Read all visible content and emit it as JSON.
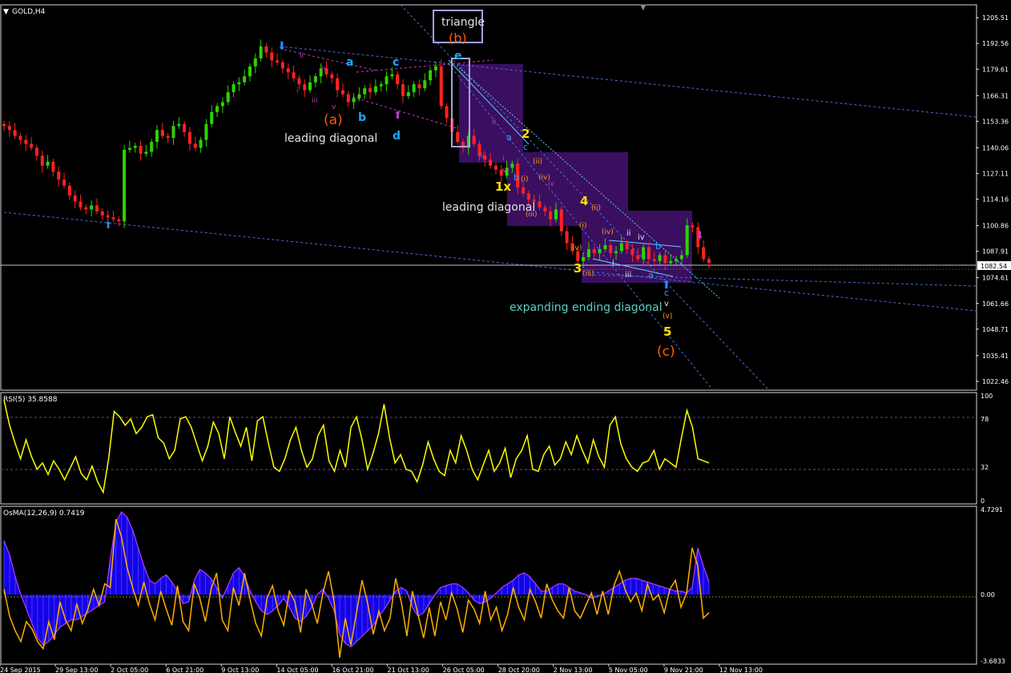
{
  "window": {
    "symbol_title": "GOLD,H4"
  },
  "colors": {
    "background": "#000000",
    "bull_candle": "#2bd400",
    "bear_candle": "#ff2222",
    "rsi_line": "#ffff00",
    "osma_histogram": "#1a00ff",
    "osma_line": "#ffb000",
    "channel_lines": "#4a6fd4",
    "zone_fill": "#3a0f60",
    "last_price_box": "#ffffff"
  },
  "price_panel": {
    "last_price": "1082.54",
    "y_ticks": [
      "1205.51",
      "1192.56",
      "1179.61",
      "1166.31",
      "1153.36",
      "1140.06",
      "1127.11",
      "1114.16",
      "1100.86",
      "1087.91",
      "1074.61",
      "1061.66",
      "1048.71",
      "1035.41",
      "1022.46"
    ]
  },
  "rsi_panel": {
    "label": "RSI(5) 35.8588",
    "y_ticks": [
      "100",
      "78",
      "32",
      "0"
    ]
  },
  "osma_panel": {
    "label": "OsMA(12,26,9) 0.7419",
    "y_ticks": [
      "4.7291",
      "0.00",
      "-3.6833"
    ]
  },
  "x_ticks": [
    "24 Sep 2015",
    "29 Sep 13:00",
    "2 Oct 05:00",
    "6 Oct 21:00",
    "9 Oct 13:00",
    "14 Oct 05:00",
    "16 Oct 21:00",
    "21 Oct 13:00",
    "26 Oct 05:00",
    "28 Oct 20:00",
    "2 Nov 13:00",
    "5 Nov 05:00",
    "9 Nov 21:00",
    "12 Nov 13:00"
  ],
  "annotations": {
    "triangle": "triangle",
    "wave_b_big": "(b)",
    "wave_a_big": "(a)",
    "wave_c_big": "(c)",
    "leading_diagonal_1": "leading diagonal",
    "leading_diagonal_2": "leading diagonal",
    "expanding_ending_diagonal": "expanding ending diagonal",
    "tri_a": "a",
    "tri_b": "b",
    "tri_c": "c",
    "tri_d": "d",
    "tri_e": "e",
    "w_1x": "1x",
    "w_2": "2",
    "w_3": "3",
    "w_4": "4",
    "w_5": "5",
    "ld_ii": "ii",
    "ld_iv": "iv",
    "ld_i": "i",
    "ld_iii": "iii",
    "ld_v": "v",
    "sub_ii_a": "(ii)",
    "sub_i_a": "(i)",
    "sub_iv_a": "(iv)",
    "sub_iii_a": "(iii)",
    "sub_ii_b": "(ii)",
    "sub_i_b": "(i)",
    "sub_iv_b": "(iv)",
    "sub_v_b": "(v)",
    "sub_iii_b": "(iii)",
    "sub_v_c": "(v)",
    "m_ii": "ii",
    "m_iv": "iv",
    "m_i": "i",
    "m_iii": "iii",
    "m_v": "v",
    "e_ii": "ii",
    "e_iv": "iv",
    "e_i": "i",
    "e_iii": "iii",
    "e_v": "v",
    "e_a": "a",
    "e_b": "b",
    "e_c": "c",
    "s_a": "a",
    "s_b": "b",
    "s_c": "c"
  },
  "chart_data": [
    {
      "type": "candlestick",
      "title": "GOLD,H4",
      "ylim": [
        1018,
        1212
      ],
      "last_price": 1082.54,
      "series": [
        {
          "name": "GOLD,H4",
          "close": [
            1151,
            1149,
            1146,
            1144,
            1142,
            1140,
            1136,
            1131,
            1133,
            1128,
            1124,
            1121,
            1116,
            1113,
            1110,
            1109,
            1111,
            1108,
            1106,
            1105,
            1104,
            1103,
            1139,
            1140,
            1141,
            1137,
            1138,
            1143,
            1149,
            1146,
            1145,
            1151,
            1152,
            1148,
            1142,
            1140,
            1144,
            1152,
            1158,
            1161,
            1163,
            1168,
            1172,
            1173,
            1176,
            1181,
            1185,
            1191,
            1188,
            1184,
            1183,
            1180,
            1178,
            1175,
            1172,
            1169,
            1173,
            1176,
            1180,
            1177,
            1175,
            1169,
            1167,
            1163,
            1165,
            1167,
            1170,
            1168,
            1171,
            1172,
            1176,
            1177,
            1172,
            1166,
            1168,
            1172,
            1170,
            1174,
            1179,
            1181,
            1161,
            1155,
            1148,
            1143,
            1140,
            1146,
            1142,
            1136,
            1134,
            1131,
            1129,
            1126,
            1130,
            1132,
            1120,
            1117,
            1114,
            1113,
            1110,
            1108,
            1104,
            1109,
            1098,
            1092,
            1088,
            1083,
            1085,
            1089,
            1087,
            1089,
            1091,
            1087,
            1088,
            1092,
            1089,
            1086,
            1084,
            1090,
            1084,
            1083,
            1086,
            1082,
            1083,
            1084,
            1086,
            1101,
            1100,
            1090,
            1084,
            1082
          ]
        }
      ],
      "annotations": [
        "triangle",
        "(b)",
        "(a)",
        "(c)",
        "leading diagonal",
        "leading diagonal",
        "expanding ending diagonal",
        "a",
        "b",
        "c",
        "d",
        "e",
        "1x",
        "2",
        "3",
        "4",
        "5"
      ]
    },
    {
      "type": "line",
      "title": "RSI(5) 35.8588",
      "ylim": [
        0,
        100
      ],
      "levels": [
        78,
        32
      ],
      "series": [
        {
          "name": "RSI(5) 35.8588",
          "values": [
            96,
            72,
            55,
            40,
            58,
            42,
            30,
            36,
            25,
            38,
            30,
            20,
            31,
            42,
            26,
            20,
            33,
            18,
            8,
            40,
            85,
            80,
            72,
            78,
            64,
            70,
            80,
            82,
            60,
            55,
            40,
            48,
            78,
            80,
            70,
            54,
            38,
            52,
            75,
            64,
            40,
            80,
            65,
            52,
            70,
            38,
            76,
            80,
            55,
            32,
            28,
            40,
            58,
            70,
            48,
            32,
            40,
            62,
            72,
            38,
            28,
            48,
            32,
            70,
            80,
            58,
            30,
            45,
            64,
            92,
            60,
            36,
            44,
            30,
            28,
            18,
            34,
            56,
            40,
            28,
            24,
            48,
            36,
            62,
            48,
            30,
            20,
            34,
            48,
            28,
            36,
            50,
            22,
            40,
            48,
            62,
            30,
            28,
            44,
            52,
            34,
            40,
            56,
            44,
            62,
            48,
            36,
            58,
            42,
            32,
            72,
            80,
            54,
            40,
            32,
            28,
            36,
            38,
            48,
            30,
            40,
            36,
            32,
            60,
            86,
            70,
            40,
            38,
            36
          ]
        }
      ]
    },
    {
      "type": "bar",
      "title": "OsMA(12,26,9) 0.7419",
      "ylim": [
        -3.6833,
        4.7291
      ],
      "zero": 0.0,
      "series": [
        {
          "name": "OsMA(12,26,9) 0.7419",
          "values": [
            3.0,
            2.2,
            1.0,
            0.0,
            -0.8,
            -1.6,
            -2.4,
            -2.8,
            -2.6,
            -2.2,
            -1.8,
            -1.6,
            -1.4,
            -1.4,
            -1.2,
            -1.0,
            -0.8,
            -0.6,
            -0.4,
            2.0,
            4.0,
            4.6,
            4.3,
            3.6,
            2.6,
            1.6,
            0.8,
            0.6,
            0.9,
            1.1,
            0.7,
            0.2,
            -0.5,
            -0.4,
            0.8,
            1.4,
            1.2,
            0.9,
            0.4,
            -0.2,
            0.5,
            1.2,
            1.5,
            1.0,
            0.2,
            -0.4,
            -0.9,
            -1.1,
            -0.9,
            -0.6,
            -0.2,
            -0.7,
            -1.3,
            -1.5,
            -1.2,
            -0.7,
            0.0,
            0.3,
            -0.2,
            -0.9,
            -2.2,
            -2.7,
            -2.9,
            -2.6,
            -2.3,
            -2.0,
            -1.7,
            -1.2,
            -0.8,
            -0.3,
            0.2,
            0.4,
            0.2,
            -0.7,
            -1.2,
            -1.0,
            -0.5,
            0.0,
            0.4,
            0.5,
            0.6,
            0.6,
            0.4,
            0.1,
            -0.3,
            -0.5,
            -0.4,
            -0.2,
            0.1,
            0.4,
            0.6,
            0.8,
            1.1,
            1.2,
            1.0,
            0.6,
            0.2,
            0.2,
            0.4,
            0.6,
            0.6,
            0.4,
            0.2,
            0.1,
            0.0,
            -0.2,
            -0.1,
            0.0,
            0.2,
            0.4,
            0.6,
            0.8,
            0.9,
            0.9,
            0.8,
            0.7,
            0.6,
            0.5,
            0.4,
            0.3,
            0.2,
            0.2,
            0.1,
            0.4,
            2.6,
            1.6,
            0.7
          ]
        },
        {
          "name": "signal",
          "values": [
            0.3,
            -1.2,
            -2.0,
            -2.6,
            -1.5,
            -1.9,
            -2.6,
            -3.0,
            -1.5,
            -2.5,
            -0.4,
            -1.4,
            -2.0,
            -0.5,
            -1.6,
            -0.8,
            0.3,
            -0.6,
            0.6,
            0.4,
            4.2,
            3.2,
            1.5,
            0.4,
            -0.6,
            0.7,
            -0.5,
            -1.4,
            0.2,
            -0.8,
            -1.7,
            0.5,
            -1.5,
            -2.0,
            0.6,
            -0.2,
            -1.5,
            0.3,
            1.2,
            -1.4,
            -2.0,
            0.4,
            -0.6,
            1.2,
            -0.3,
            -1.6,
            -2.3,
            -0.2,
            0.5,
            -0.9,
            -1.7,
            0.2,
            -0.4,
            -2.1,
            0.3,
            -0.5,
            -1.6,
            0.1,
            1.3,
            -0.4,
            -3.5,
            -1.3,
            -2.8,
            -1.0,
            0.8,
            -0.5,
            -2.2,
            -0.9,
            -2.0,
            -1.3,
            0.9,
            -0.4,
            -2.3,
            0.2,
            -1.1,
            -2.4,
            -0.7,
            -2.3,
            -0.4,
            -1.4,
            0.1,
            -0.8,
            -2.1,
            -0.3,
            -0.8,
            -1.6,
            0.2,
            -1.4,
            -0.7,
            -2.0,
            -1.1,
            0.4,
            -0.7,
            -1.4,
            0.3,
            -0.4,
            -1.3,
            0.6,
            -0.3,
            -0.9,
            -1.3,
            0.4,
            -0.9,
            -1.3,
            -0.6,
            0.1,
            -1.1,
            0.2,
            -1.1,
            0.5,
            1.3,
            0.3,
            -0.4,
            0.1,
            -0.9,
            0.6,
            -0.3,
            0.0,
            -1.0,
            0.3,
            0.8,
            -0.7,
            0.1,
            2.6,
            1.6,
            -1.3,
            -1.0
          ]
        }
      ]
    }
  ]
}
